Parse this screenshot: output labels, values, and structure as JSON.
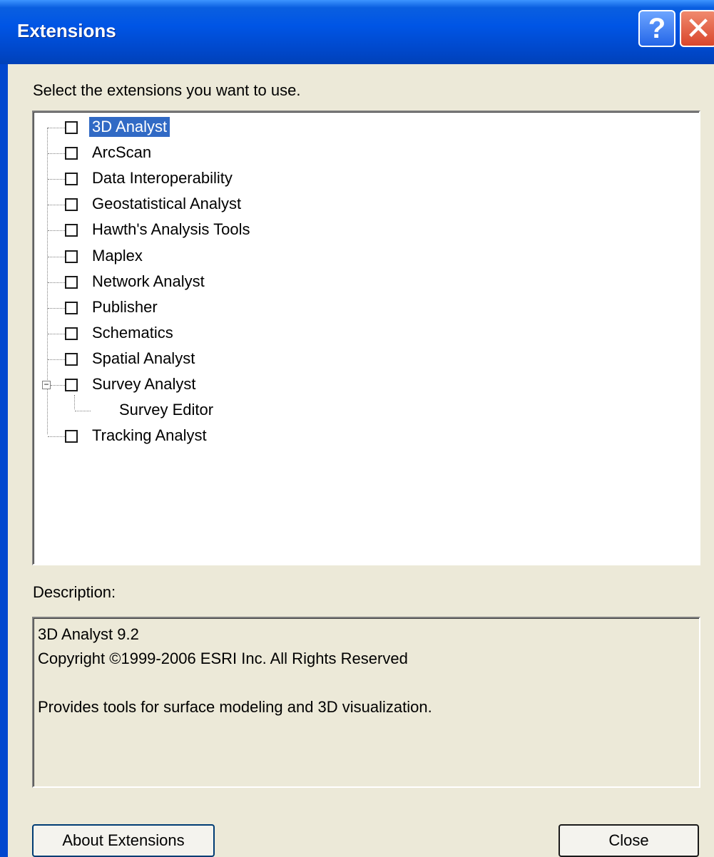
{
  "window": {
    "title": "Extensions",
    "help_glyph": "?",
    "close_glyph": "✕"
  },
  "prompt": "Select the extensions you want to use.",
  "tree": {
    "items": [
      {
        "label": "3D Analyst",
        "checked": false,
        "selected": true
      },
      {
        "label": "ArcScan",
        "checked": false
      },
      {
        "label": "Data Interoperability",
        "checked": false
      },
      {
        "label": "Geostatistical Analyst",
        "checked": false
      },
      {
        "label": "Hawth's Analysis Tools",
        "checked": false
      },
      {
        "label": "Maplex",
        "checked": false
      },
      {
        "label": "Network Analyst",
        "checked": false
      },
      {
        "label": "Publisher",
        "checked": false
      },
      {
        "label": "Schematics",
        "checked": false
      },
      {
        "label": "Spatial Analyst",
        "checked": false
      },
      {
        "label": "Survey Analyst",
        "checked": false,
        "expanded": true,
        "expander_glyph": "−"
      },
      {
        "label": "Survey Editor",
        "child": true
      },
      {
        "label": "Tracking Analyst",
        "checked": false
      }
    ]
  },
  "description": {
    "label": "Description:",
    "lines": [
      "3D Analyst 9.2",
      "Copyright ©1999-2006 ESRI Inc. All Rights Reserved",
      "",
      "Provides tools for surface modeling and 3D visualization."
    ]
  },
  "buttons": {
    "about": "About Extensions",
    "close": "Close"
  },
  "colors": {
    "titlebar": "#0055e5",
    "selection": "#316ac5",
    "dialog_bg": "#ece9d8"
  }
}
